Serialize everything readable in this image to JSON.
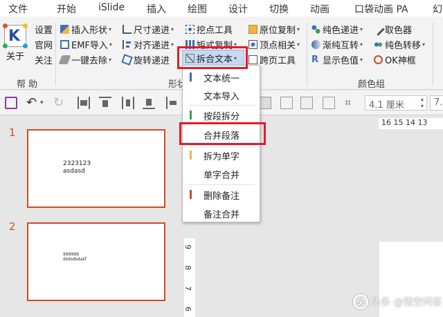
{
  "tabs": [
    "文件",
    "开始",
    "iSlide",
    "插入",
    "绘图",
    "设计",
    "切换",
    "动画",
    "口袋动画 PA",
    "幻"
  ],
  "ribbon": {
    "help_group": {
      "big_button": "关于",
      "items": [
        "设置",
        "官网",
        "关注"
      ],
      "label": "帮 助"
    },
    "shape_group": {
      "col1": [
        "插入形状",
        "EMF导入",
        "一键去除"
      ],
      "col2": [
        "尺寸递进",
        "对齐递进",
        "旋转递进"
      ],
      "col3": [
        "挖点工具",
        "矩式复制",
        "拆合文本"
      ],
      "col4": [
        "原位复制",
        "顶点相关",
        "跨页工具"
      ],
      "label": "形状"
    },
    "color_group": {
      "col1": [
        "纯色递进",
        "渐纯互转",
        "显示色值"
      ],
      "col2": [
        "取色器",
        "纯色转移",
        "OK神框"
      ],
      "label": "颜色组"
    }
  },
  "dropdown": {
    "items": [
      {
        "label": "文本统一",
        "bar": "#3b6fb6"
      },
      {
        "label": "文本导入",
        "bar": ""
      },
      {
        "label": "按段拆分",
        "bar": "#3f9a5a"
      },
      {
        "label": "合并段落",
        "bar": ""
      },
      {
        "label": "拆为单字",
        "bar": "#f0b44c"
      },
      {
        "label": "单字合并",
        "bar": ""
      },
      {
        "label": "删除备注",
        "bar": "#d24726"
      },
      {
        "label": "备注合并",
        "bar": ""
      }
    ]
  },
  "qat": {
    "size_field": "4.1 厘米",
    "size_field2": "7."
  },
  "rulers": {
    "horizontal": "16 15 14 13",
    "vertical": [
      "9",
      "8",
      "7",
      "6"
    ]
  },
  "slides": [
    {
      "number": "1",
      "lines": [
        "2323123",
        "asdasd"
      ]
    },
    {
      "number": "2",
      "lines": [
        "999999",
        "dsdsdsdasf"
      ]
    }
  ],
  "watermark": "头条 @悟空问答",
  "colors": {
    "accent": "#d24726",
    "highlight": "#e21a2c",
    "selected": "#c6d9f0"
  }
}
